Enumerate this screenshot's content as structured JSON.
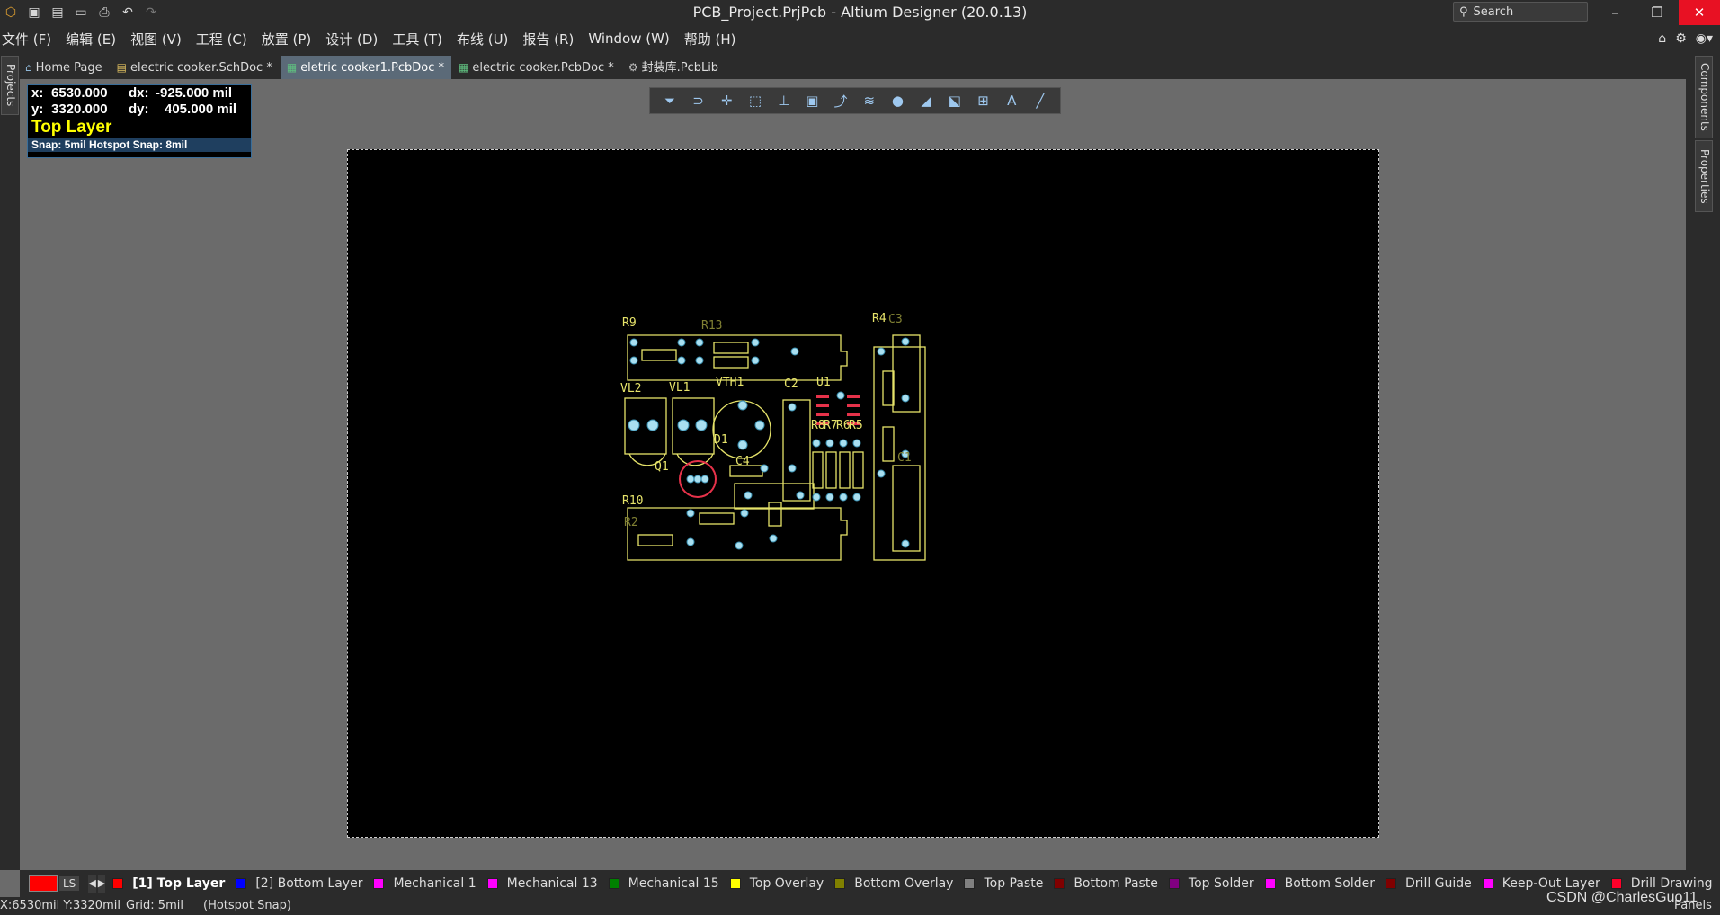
{
  "window": {
    "title": "PCB_Project.PrjPcb - Altium Designer (20.0.13)",
    "search_placeholder": "Search",
    "minimize": "–",
    "restore": "❐",
    "close": "✕"
  },
  "menu": [
    "文件 (F)",
    "编辑 (E)",
    "视图 (V)",
    "工程 (C)",
    "放置 (P)",
    "设计 (D)",
    "工具 (T)",
    "布线 (U)",
    "报告 (R)",
    "Window (W)",
    "帮助 (H)"
  ],
  "side_panels": {
    "left": "Projects",
    "right_top": "Components",
    "right_bottom": "Properties"
  },
  "tabs": [
    {
      "label": "Home Page",
      "icon": "home-icon"
    },
    {
      "label": "electric cooker.SchDoc *",
      "icon": "schematic-icon"
    },
    {
      "label": "eletric cooker1.PcbDoc *",
      "icon": "pcb-icon",
      "active": true
    },
    {
      "label": "electric cooker.PcbDoc *",
      "icon": "pcb-icon"
    },
    {
      "label": "封装库.PcbLib",
      "icon": "library-icon"
    }
  ],
  "hud": {
    "x_label": "x:",
    "x": "6530.000",
    "dx_label": "dx:",
    "dx": "-925.000 mil",
    "y_label": "y:",
    "y": "3320.000",
    "dy_label": "dy:",
    "dy": "405.000 mil",
    "layer": "Top Layer",
    "snap": "Snap: 5mil Hotspot Snap: 8mil"
  },
  "layers": [
    {
      "name": "[1] Top Layer",
      "color": "#ff0000",
      "active": true
    },
    {
      "name": "[2] Bottom Layer",
      "color": "#0000ff"
    },
    {
      "name": "Mechanical 1",
      "color": "#ff00ff"
    },
    {
      "name": "Mechanical 13",
      "color": "#ff00ff"
    },
    {
      "name": "Mechanical 15",
      "color": "#008000"
    },
    {
      "name": "Top Overlay",
      "color": "#ffff00"
    },
    {
      "name": "Bottom Overlay",
      "color": "#808000"
    },
    {
      "name": "Top Paste",
      "color": "#808080"
    },
    {
      "name": "Bottom Paste",
      "color": "#800000"
    },
    {
      "name": "Top Solder",
      "color": "#800080"
    },
    {
      "name": "Bottom Solder",
      "color": "#ff00ff"
    },
    {
      "name": "Drill Guide",
      "color": "#800000"
    },
    {
      "name": "Keep-Out Layer",
      "color": "#ff00ff"
    },
    {
      "name": "Drill Drawing",
      "color": "#ff002a"
    }
  ],
  "layer_set": "LS",
  "status": {
    "coords": "X:6530mil Y:3320mil",
    "grid": "Grid: 5mil",
    "snap": "(Hotspot Snap)",
    "panels": "Panels"
  },
  "designators": {
    "r9": "R9",
    "r13": "R13",
    "r4": "R4",
    "c3": "C3",
    "vl2": "VL2",
    "vl1": "VL1",
    "vth1": "VTH1",
    "c2": "C2",
    "u1": "U1",
    "r8": "R8",
    "r7": "R7",
    "r6": "R6",
    "r5": "R5",
    "d1": "D1",
    "c4": "C4",
    "q1": "Q1",
    "r10": "R10",
    "r2": "R2",
    "c1": "C1"
  },
  "watermark": "CSDN @CharlesGuo11"
}
